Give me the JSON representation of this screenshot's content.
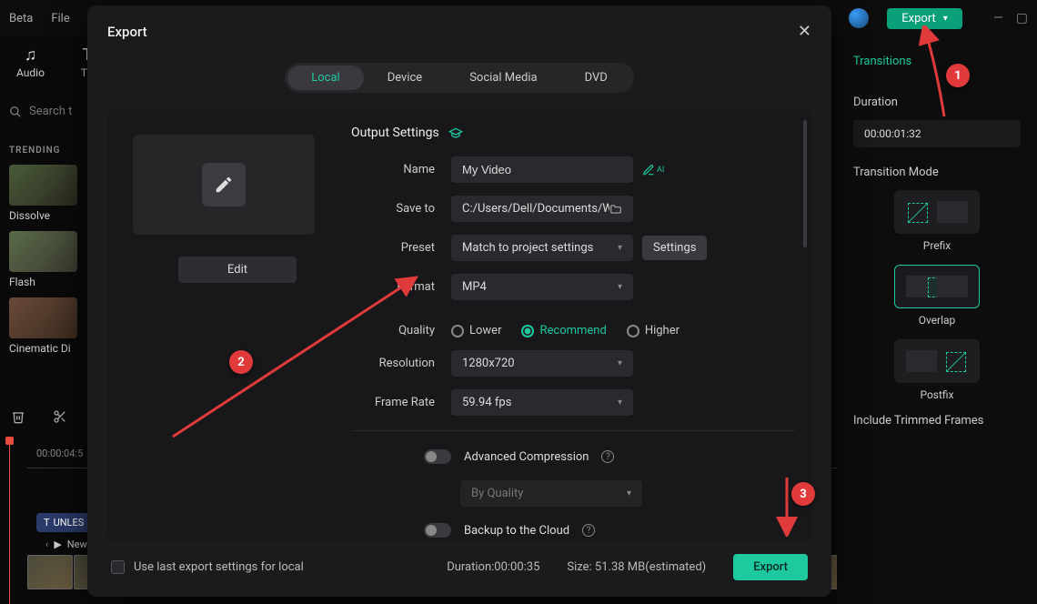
{
  "topbar": {
    "menu_beta": "Beta",
    "menu_file": "File",
    "export_label": "Export"
  },
  "left_tools": {
    "audio": "Audio",
    "titles": "Tit",
    "search_placeholder": "Search t"
  },
  "sidebar": {
    "heading": "TRENDING",
    "items": [
      {
        "label": "Dissolve"
      },
      {
        "label": "Flash"
      },
      {
        "label": "Cinematic Di"
      }
    ]
  },
  "timeline": {
    "timecode": "00:00:04:5",
    "chip": "UNLES",
    "clip_name": "New E"
  },
  "right_panel": {
    "tab": "Transitions",
    "duration_label": "Duration",
    "duration_value": "00:00:01:32",
    "mode_label": "Transition Mode",
    "modes": [
      {
        "label": "Prefix"
      },
      {
        "label": "Overlap"
      },
      {
        "label": "Postfix"
      }
    ],
    "include": "Include Trimmed Frames"
  },
  "modal": {
    "title": "Export",
    "tabs": [
      "Local",
      "Device",
      "Social Media",
      "DVD"
    ],
    "edit_btn": "Edit",
    "section": "Output Settings",
    "name_label": "Name",
    "name_value": "My Video",
    "saveto_label": "Save to",
    "saveto_value": "C:/Users/Dell/Documents/Wo",
    "preset_label": "Preset",
    "preset_value": "Match to project settings",
    "settings_btn": "Settings",
    "format_label": "Format",
    "format_value": "MP4",
    "quality_label": "Quality",
    "quality_options": [
      "Lower",
      "Recommend",
      "Higher"
    ],
    "resolution_label": "Resolution",
    "resolution_value": "1280x720",
    "framerate_label": "Frame Rate",
    "framerate_value": "59.94 fps",
    "adv_compression": "Advanced Compression",
    "byquality": "By Quality",
    "backup_cloud": "Backup to the Cloud",
    "uselast": "Use last export settings for local",
    "duration_text": "Duration:00:00:35",
    "size_text": "Size: 51.38 MB(estimated)",
    "export_btn": "Export"
  },
  "annotations": {
    "n1": "1",
    "n2": "2",
    "n3": "3"
  }
}
